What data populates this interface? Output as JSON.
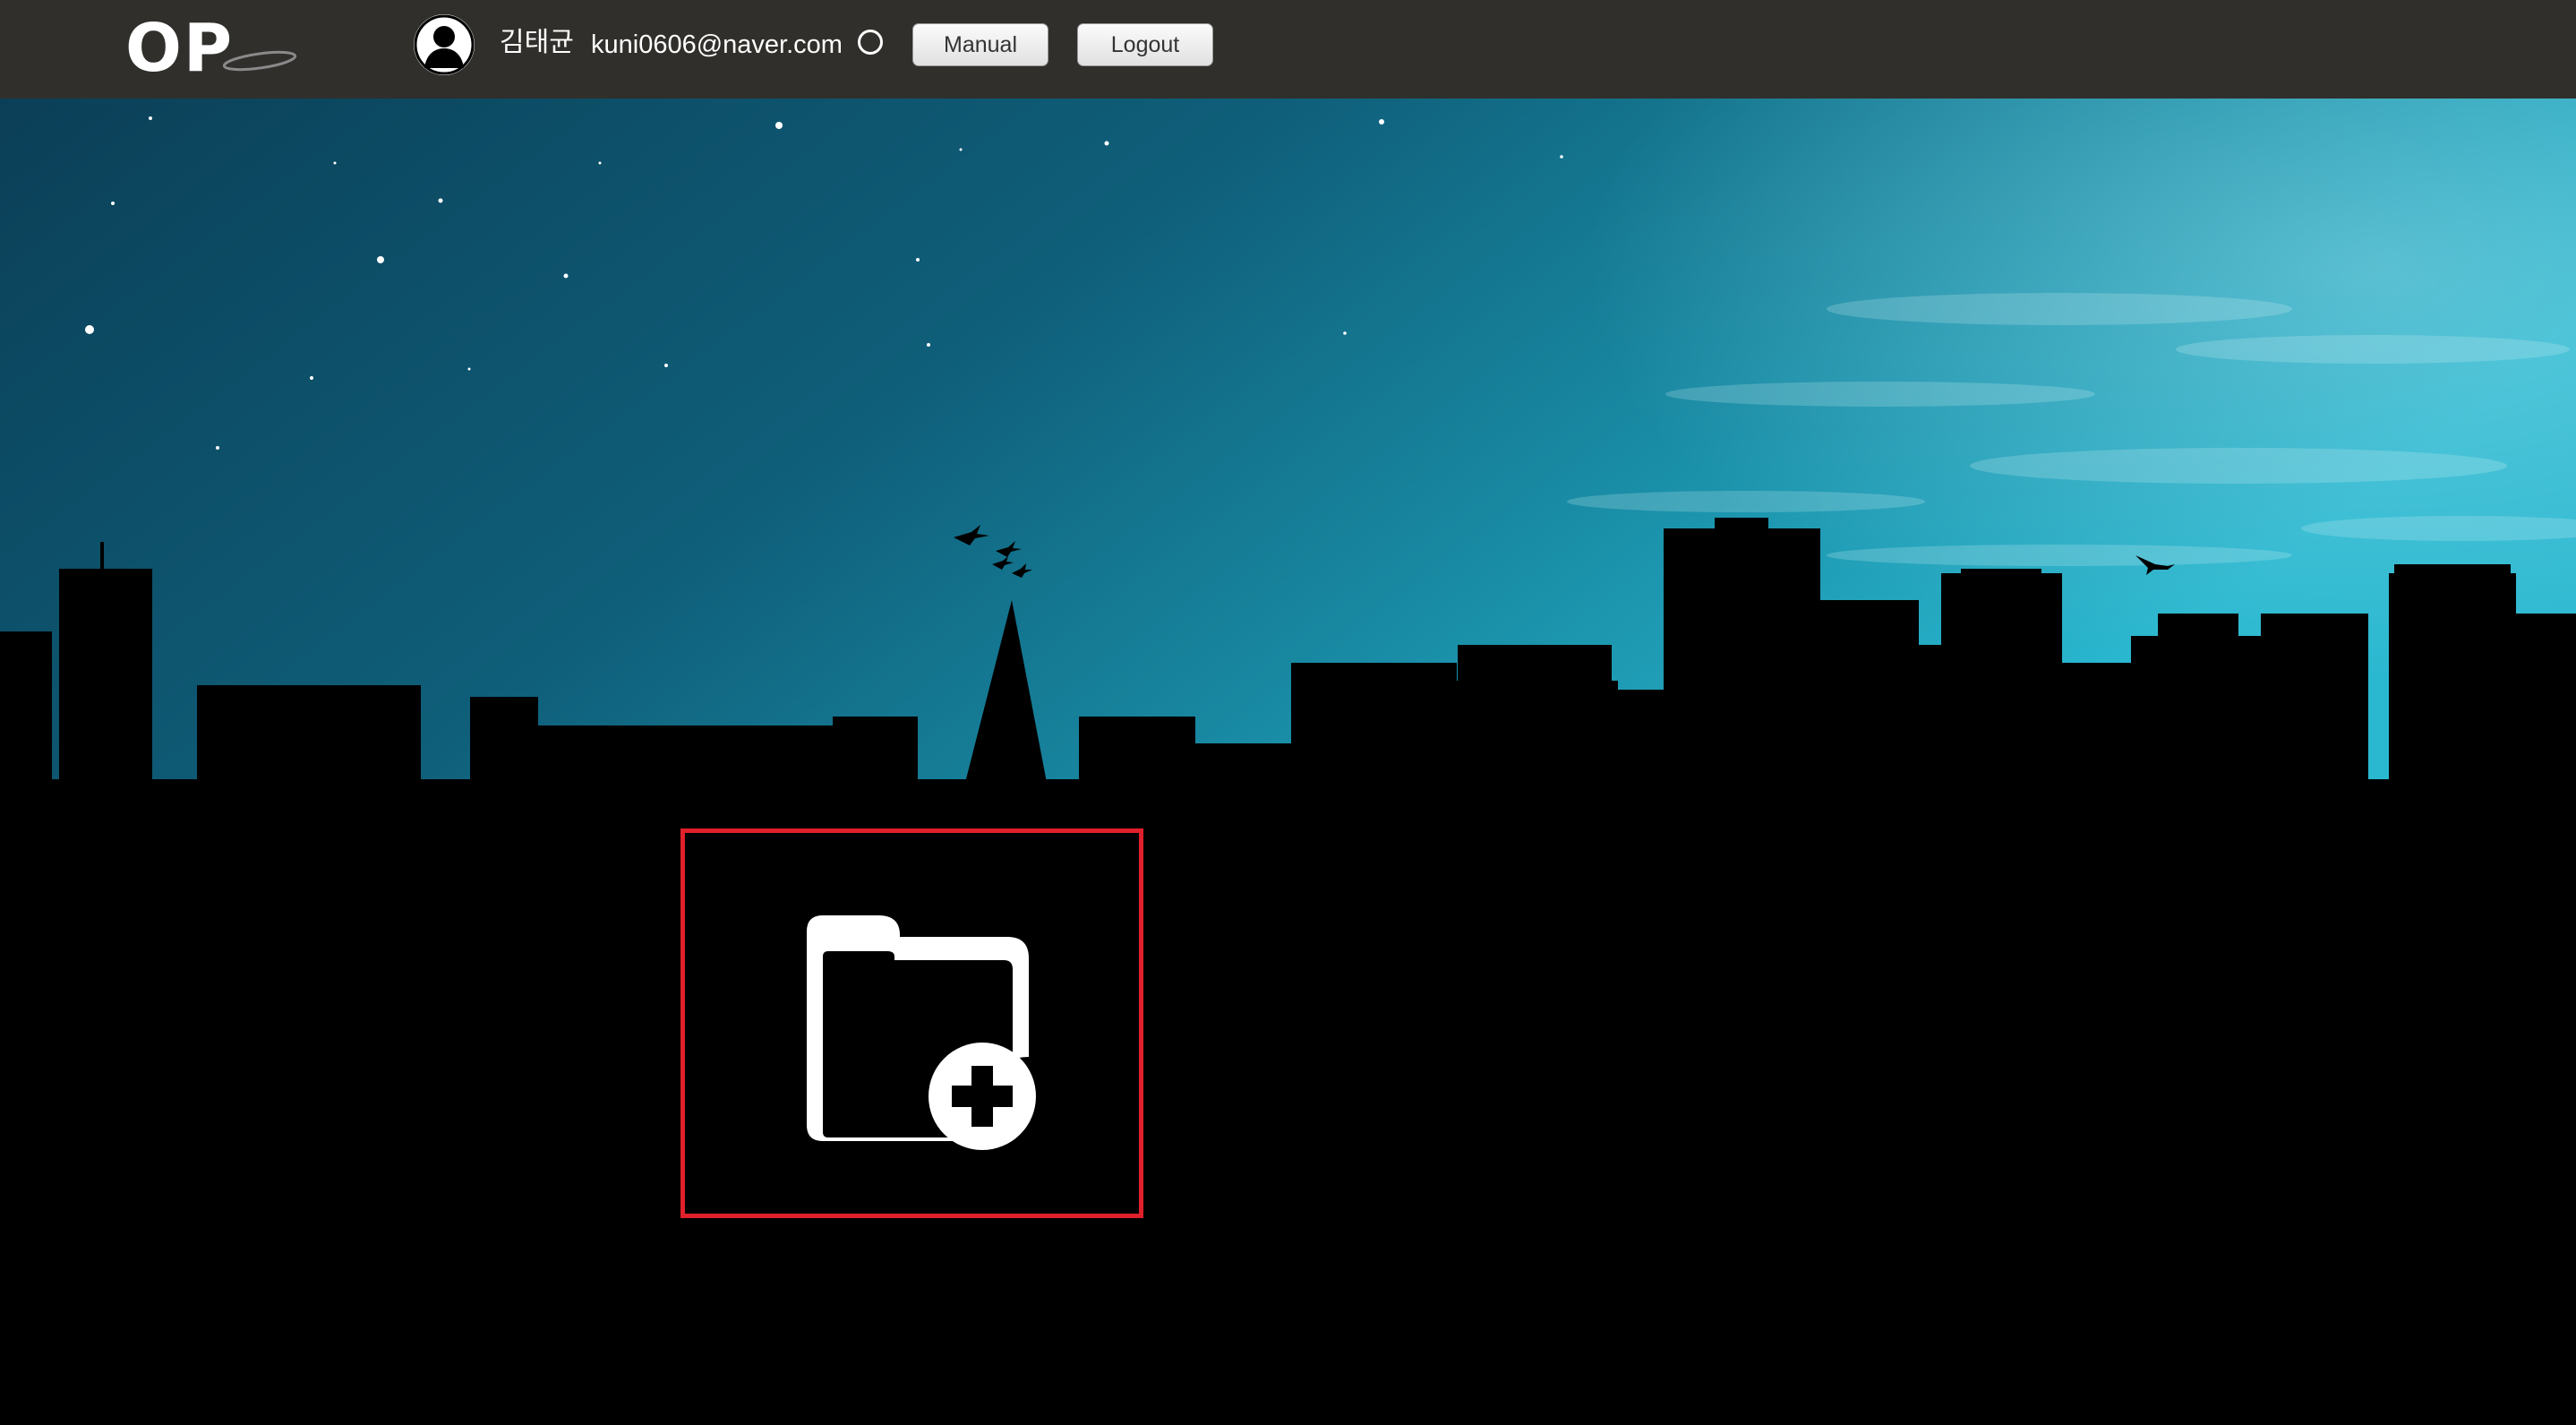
{
  "header": {
    "logo_text": "OP",
    "user_name": "김태균",
    "user_email": "kuni0606@naver.com",
    "manual_label": "Manual",
    "logout_label": "Logout"
  },
  "icons": {
    "avatar": "user-silhouette-icon",
    "status": "status-ring-icon",
    "add_folder": "folder-plus-icon"
  },
  "colors": {
    "header_bg": "#302f2b",
    "add_folder_border": "#e0202a",
    "sky_top": "#0d4a63",
    "sky_right": "#25b3cc"
  }
}
